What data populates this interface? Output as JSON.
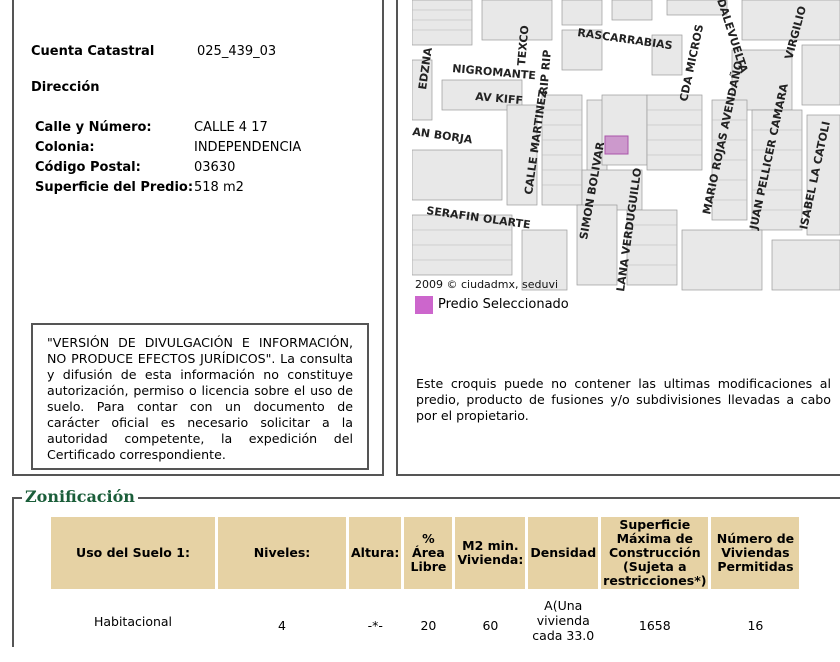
{
  "predio": {
    "cuenta_label": "Cuenta Catastral",
    "cuenta_value": "025_439_03",
    "direccion_label": "Dirección",
    "calle_label": "Calle y Número:",
    "calle_value": "CALLE 4 17",
    "colonia_label": "Colonia:",
    "colonia_value": "INDEPENDENCIA",
    "cp_label": "Código Postal:",
    "cp_value": "03630",
    "superficie_label": "Superficie del Predio:",
    "superficie_value": "518 m2"
  },
  "disclaimer": "\"VERSIÓN DE DIVULGACIÓN E INFORMACIÓN, NO PRODUCE EFECTOS JURÍDICOS\". La consulta y difusión de esta información no constituye autorización, permiso o licencia sobre el uso de suelo. Para contar con un documento de carácter oficial es necesario solicitar a la autoridad competente, la expedición del Certificado correspondiente.",
  "map": {
    "streets": [
      "RASCARRABIAS",
      "NIGROMANTE",
      "AV KIFF",
      "AN BORJA",
      "SERAFIN OLARTE",
      "TEXCO",
      "RIP RIP",
      "CALLE MARTINEZ",
      "SIMON BOLIVAR",
      "LANA VERDUGUILLO",
      "CDA MICROS",
      "MARIO ROJAS AVENDAÑO",
      "JUAN PELLICER CAMARA",
      "ISABEL LA CATOLI",
      "DALEVUELTA",
      "VIRGILIO",
      "EDZNA"
    ],
    "copyright": "2009 © ciudadmx, seduvi",
    "highlight_color": "#cc99cc"
  },
  "legend": {
    "label": "Predio Seleccionado",
    "color": "#cc66cc"
  },
  "croquis_note": "Este croquis puede no contener las ultimas modificaciones al predio, producto de fusiones y/o subdivisiones llevadas a cabo por el propietario.",
  "zonificacion": {
    "title": "Zonificación",
    "headers": [
      "Uso del Suelo 1:",
      "Niveles:",
      "Altura:",
      "% Área Libre",
      "M2 min. Vivienda:",
      "Densidad",
      "Superficie Máxima de Construcción (Sujeta a restricciones*)",
      "Número de Viviendas Permitidas"
    ],
    "row": [
      "Habitacional",
      "4",
      "-*-",
      "20",
      "60",
      "A(Una vivienda cada 33.0",
      "1658",
      "16"
    ],
    "header_color": "#e6d2a4",
    "title_color": "#1b5e3a"
  }
}
